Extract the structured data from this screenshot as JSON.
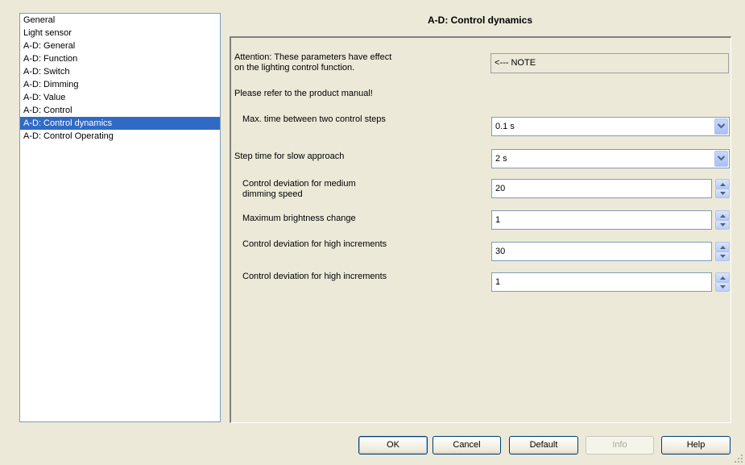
{
  "sidebar": {
    "items": [
      {
        "label": "General"
      },
      {
        "label": "Light sensor"
      },
      {
        "label": "A-D: General"
      },
      {
        "label": "A-D: Function"
      },
      {
        "label": "A-D: Switch"
      },
      {
        "label": "A-D: Dimming"
      },
      {
        "label": "A-D: Value"
      },
      {
        "label": "A-D: Control"
      },
      {
        "label": "A-D: Control dynamics",
        "selected": true
      },
      {
        "label": "A-D: Control Operating"
      }
    ]
  },
  "page": {
    "title": "A-D: Control dynamics",
    "attention_line1": "Attention: These parameters have effect",
    "attention_line2": "on the lighting control function.",
    "note_value": "<--- NOTE",
    "refer_text": "Please refer to the product manual!"
  },
  "params": {
    "max_time": {
      "label": "Max. time between two control steps",
      "value": "0.1 s"
    },
    "step_time": {
      "label": "Step time for slow approach",
      "value": "2 s"
    },
    "deviation_medium": {
      "label_line1": "Control deviation for medium",
      "label_line2": "dimming speed",
      "value": "20"
    },
    "max_brightness": {
      "label": "Maximum brightness change",
      "value": "1"
    },
    "deviation_high_1": {
      "label": "Control deviation for high increments",
      "value": "30"
    },
    "deviation_high_2": {
      "label": "Control deviation for high increments",
      "value": "1"
    }
  },
  "buttons": {
    "ok": "OK",
    "cancel": "Cancel",
    "default": "Default",
    "info": "Info",
    "help": "Help"
  },
  "colors": {
    "selection": "#316ac5",
    "background": "#ece9d8"
  }
}
